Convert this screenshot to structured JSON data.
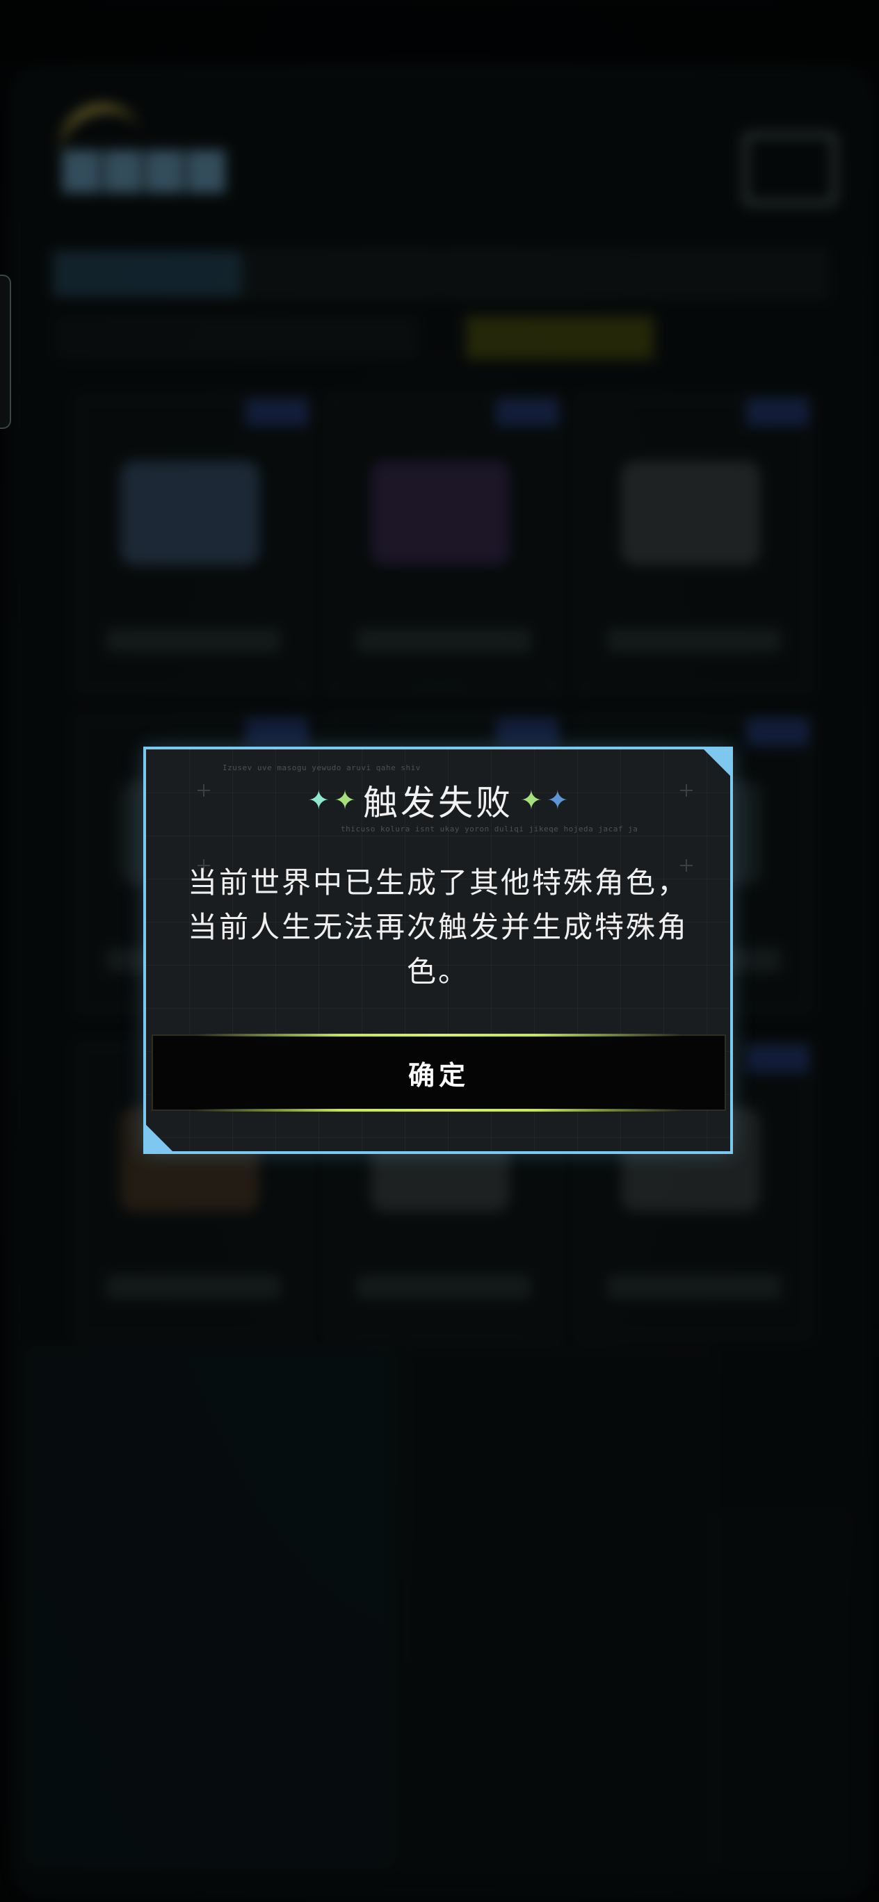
{
  "dialog": {
    "title": "触发失败",
    "deco_text_1": "Izusev uve masogu yewudo aruvi qahe shiv",
    "deco_text_2": "thicuso kolura isnt ukay yoron duliqi jikeqe hojeda jacaf ja",
    "message": "当前世界中已生成了其他特殊角色，当前人生无法再次触发并生成特殊角色。",
    "confirm_label": "确定",
    "border_color": "#7ec7ef",
    "accent_color": "#c6e84e",
    "sparkle_left": [
      "sparkle-mint-icon",
      "sparkle-green-icon"
    ],
    "sparkle_right": [
      "sparkle-green-icon",
      "sparkle-blue-icon"
    ]
  },
  "icons": {
    "sparkle_glyph": "✦"
  }
}
